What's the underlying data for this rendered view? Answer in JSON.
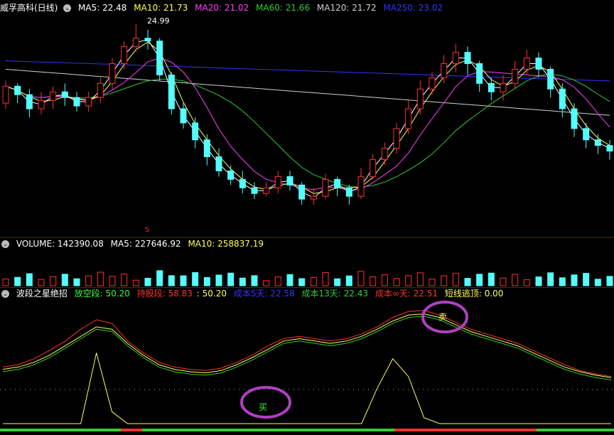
{
  "main_panel": {
    "title": "威孚高科(日线)",
    "ma5_label": "MA5: 22.48",
    "ma10_label": "MA10: 21.73",
    "ma20_label": "MA20: 21.02",
    "ma60_label": "MA60: 21.66",
    "ma120_label": "MA120: 21.72",
    "ma250_label": "MA250: 23.02",
    "peak_label": "24.99",
    "marker_label": "S"
  },
  "volume_panel": {
    "volume_label": "VOLUME: 142390.08",
    "ma5_label": "MA5: 227646.92",
    "ma10_label": "MA10: 258837.19"
  },
  "indicator_panel": {
    "title": "波段之星绝招",
    "fangkong_label": "放空段: 50.20",
    "chigu_label": "持股段: 58.83",
    "value_label": ": 50.20",
    "cost5_label": "成本5天: 22.58",
    "cost13_label": "成本13天: 22.43",
    "costinf_label": "成本∞天: 22.51",
    "short_escape_label": "短线逃顶: 0.00",
    "buy_signal": "买",
    "sell_signal": "卖"
  },
  "colors": {
    "up": "#ff3030",
    "down": "#54ffff",
    "ma5": "#ffffff",
    "ma10": "#ffff55",
    "ma20": "#ff40ff",
    "ma60": "#33cc33",
    "ma120": "#d0d0d0",
    "ma250": "#3333ff",
    "circle": "#b040c0"
  },
  "chart_data": {
    "type": "candlestick",
    "y_peak": 24.99,
    "candles": [
      [
        22.2,
        22.8,
        23.0,
        22.0
      ],
      [
        22.8,
        22.5,
        22.9,
        22.2
      ],
      [
        22.5,
        22.0,
        22.7,
        21.7
      ],
      [
        22.0,
        22.3,
        22.6,
        21.8
      ],
      [
        22.3,
        22.6,
        22.8,
        22.0
      ],
      [
        22.6,
        22.4,
        22.9,
        22.1
      ],
      [
        22.4,
        22.1,
        22.6,
        21.9
      ],
      [
        22.1,
        22.4,
        22.6,
        21.9
      ],
      [
        22.4,
        22.9,
        23.1,
        22.2
      ],
      [
        22.9,
        23.6,
        23.8,
        22.7
      ],
      [
        23.6,
        24.2,
        24.4,
        23.4
      ],
      [
        24.2,
        24.5,
        24.99,
        24.0
      ],
      [
        24.5,
        24.4,
        24.8,
        24.1
      ],
      [
        24.4,
        23.2,
        24.5,
        23.0
      ],
      [
        23.2,
        22.0,
        23.3,
        21.8
      ],
      [
        22.0,
        21.5,
        22.2,
        21.3
      ],
      [
        21.5,
        20.9,
        21.7,
        20.6
      ],
      [
        20.9,
        20.3,
        21.1,
        20.0
      ],
      [
        20.3,
        19.8,
        20.6,
        19.6
      ],
      [
        19.8,
        19.5,
        20.0,
        19.3
      ],
      [
        19.5,
        19.2,
        19.8,
        19.0
      ],
      [
        19.2,
        19.0,
        19.4,
        18.8
      ],
      [
        19.0,
        19.2,
        19.4,
        18.9
      ],
      [
        19.2,
        19.6,
        19.8,
        19.0
      ],
      [
        19.6,
        19.3,
        19.8,
        19.1
      ],
      [
        19.3,
        18.8,
        19.4,
        18.6
      ],
      [
        18.8,
        18.9,
        19.2,
        18.6
      ],
      [
        18.9,
        19.5,
        19.7,
        18.8
      ],
      [
        19.5,
        19.2,
        19.6,
        18.9
      ],
      [
        19.2,
        18.9,
        19.3,
        18.6
      ],
      [
        18.9,
        19.6,
        19.9,
        18.8
      ],
      [
        19.6,
        20.2,
        20.4,
        19.5
      ],
      [
        20.2,
        20.6,
        20.8,
        20.0
      ],
      [
        20.6,
        21.3,
        21.5,
        20.4
      ],
      [
        21.3,
        22.0,
        22.3,
        21.1
      ],
      [
        22.0,
        22.7,
        23.0,
        21.8
      ],
      [
        22.7,
        23.1,
        23.3,
        22.5
      ],
      [
        23.1,
        23.6,
        23.9,
        22.9
      ],
      [
        23.6,
        24.0,
        24.3,
        23.3
      ],
      [
        24.0,
        23.6,
        24.2,
        23.2
      ],
      [
        23.6,
        22.9,
        23.7,
        22.6
      ],
      [
        22.9,
        22.6,
        23.1,
        22.3
      ],
      [
        22.6,
        22.9,
        23.2,
        22.3
      ],
      [
        22.9,
        23.4,
        23.7,
        22.7
      ],
      [
        23.4,
        23.8,
        24.1,
        23.2
      ],
      [
        23.8,
        23.4,
        24.0,
        23.1
      ],
      [
        23.4,
        22.7,
        23.5,
        22.4
      ],
      [
        22.7,
        22.0,
        22.9,
        21.7
      ],
      [
        22.0,
        21.3,
        22.2,
        21.0
      ],
      [
        21.3,
        20.9,
        21.5,
        20.6
      ],
      [
        20.9,
        20.7,
        21.1,
        20.4
      ],
      [
        20.7,
        20.5,
        20.9,
        20.2
      ]
    ],
    "indicator_red": [
      48,
      50,
      55,
      62,
      70,
      80,
      88,
      85,
      70,
      60,
      52,
      48,
      46,
      45,
      47,
      52,
      58,
      66,
      72,
      74,
      72,
      70,
      72,
      76,
      82,
      90,
      95,
      96,
      92,
      86,
      80,
      76,
      72,
      68,
      62,
      56,
      50,
      45,
      42,
      40
    ],
    "indicator_yellow": [
      46,
      48,
      52,
      58,
      66,
      74,
      82,
      80,
      68,
      58,
      50,
      46,
      44,
      43,
      45,
      50,
      56,
      63,
      70,
      72,
      70,
      68,
      70,
      74,
      80,
      87,
      92,
      93,
      90,
      84,
      78,
      74,
      70,
      66,
      60,
      54,
      48,
      44,
      41,
      39
    ],
    "indicator_green": [
      44,
      46,
      50,
      56,
      64,
      72,
      80,
      78,
      66,
      56,
      48,
      44,
      42,
      41,
      43,
      48,
      54,
      61,
      68,
      70,
      68,
      66,
      68,
      72,
      78,
      85,
      90,
      91,
      88,
      82,
      76,
      72,
      68,
      64,
      58,
      52,
      46,
      42,
      39,
      37
    ],
    "escape_line": [
      0,
      0,
      0,
      0,
      0,
      0,
      60,
      10,
      0,
      0,
      0,
      0,
      0,
      0,
      0,
      0,
      0,
      0,
      0,
      0,
      0,
      0,
      0,
      0,
      30,
      55,
      40,
      5,
      0,
      0,
      0,
      0,
      0,
      0,
      0,
      0,
      0,
      0,
      0,
      0
    ]
  }
}
